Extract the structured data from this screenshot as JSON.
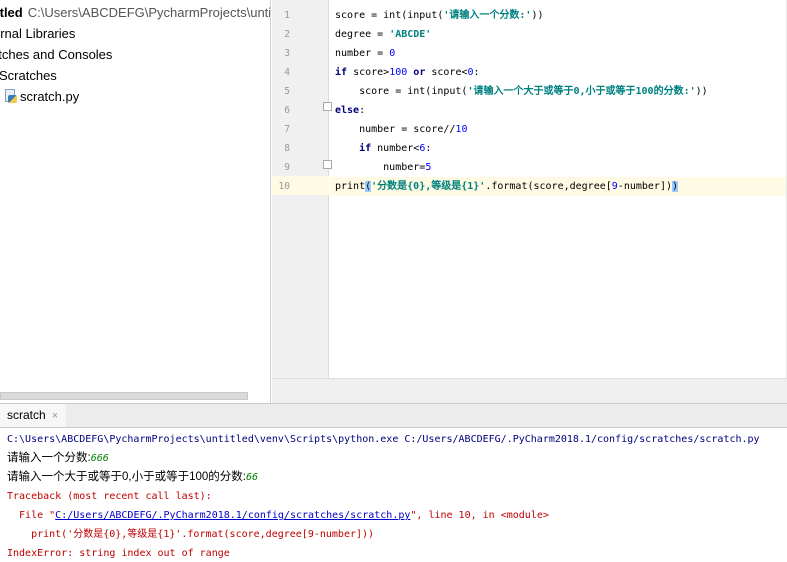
{
  "project_tree": {
    "root_name": "itled",
    "root_path": "C:\\Users\\ABCDEFG\\PycharmProjects\\untit",
    "external_libraries": "ernal Libraries",
    "scratches_and_consoles": "atches and Consoles",
    "scratches_folder": "Scratches",
    "scratch_file": "scratch.py"
  },
  "editor": {
    "line_numbers": [
      "1",
      "2",
      "3",
      "4",
      "5",
      "6",
      "7",
      "8",
      "9",
      "10"
    ],
    "lines": [
      [
        {
          "t": "score = int(input("
        },
        {
          "t": "'请输入一个分数:'",
          "c": "str"
        },
        {
          "t": "))"
        }
      ],
      [
        {
          "t": "degree = "
        },
        {
          "t": "'ABCDE'",
          "c": "str"
        }
      ],
      [
        {
          "t": "number = "
        },
        {
          "t": "0",
          "c": "num"
        }
      ],
      [
        {
          "t": "if",
          "c": "kw"
        },
        {
          "t": " score>"
        },
        {
          "t": "100",
          "c": "num"
        },
        {
          "t": " "
        },
        {
          "t": "or",
          "c": "kw"
        },
        {
          "t": " score<"
        },
        {
          "t": "0",
          "c": "num"
        },
        {
          "t": ":"
        }
      ],
      [
        {
          "t": "    score = int(input("
        },
        {
          "t": "'请输入一个大于或等于0,小于或等于100的分数:'",
          "c": "str"
        },
        {
          "t": "))"
        }
      ],
      [
        {
          "t": "else",
          "c": "kw"
        },
        {
          "t": ":"
        }
      ],
      [
        {
          "t": "    number = score//"
        },
        {
          "t": "10",
          "c": "num"
        }
      ],
      [
        {
          "t": "    "
        },
        {
          "t": "if",
          "c": "kw"
        },
        {
          "t": " number<"
        },
        {
          "t": "6",
          "c": "num"
        },
        {
          "t": ":"
        }
      ],
      [
        {
          "t": "        number="
        },
        {
          "t": "5",
          "c": "num"
        }
      ],
      [
        {
          "t": "print"
        },
        {
          "t": "(",
          "c": "brk"
        },
        {
          "t": "'分数是{0},等级是{1}'",
          "c": "str"
        },
        {
          "t": ".format(score,degree["
        },
        {
          "t": "9",
          "c": "num"
        },
        {
          "t": "-number])"
        },
        {
          "t": ")",
          "c": "brk"
        }
      ]
    ]
  },
  "run": {
    "tab_label": "scratch",
    "close_glyph": "×",
    "cmd_line": "C:\\Users\\ABCDEFG\\PycharmProjects\\untitled\\venv\\Scripts\\python.exe C:/Users/ABCDEFG/.PyCharm2018.1/config/scratches/scratch.py",
    "prompt1": "请输入一个分数:",
    "input1": "666",
    "prompt2": "请输入一个大于或等于0,小于或等于100的分数:",
    "input2": "66",
    "traceback_header": "Traceback (most recent call last):",
    "file_prefix": "  File \"",
    "file_link": "C:/Users/ABCDEFG/.PyCharm2018.1/config/scratches/scratch.py",
    "file_suffix": "\", line 10, in <module>",
    "trace_code": "    print('分数是{0},等级是{1}'.format(score,degree[9-number]))",
    "error": "IndexError: string index out of range"
  },
  "colors": {
    "keyword": "#000080",
    "string": "#008080",
    "number": "#0000ff",
    "error": "#c00000",
    "user_input": "#008000",
    "current_line": "#fffae3"
  }
}
